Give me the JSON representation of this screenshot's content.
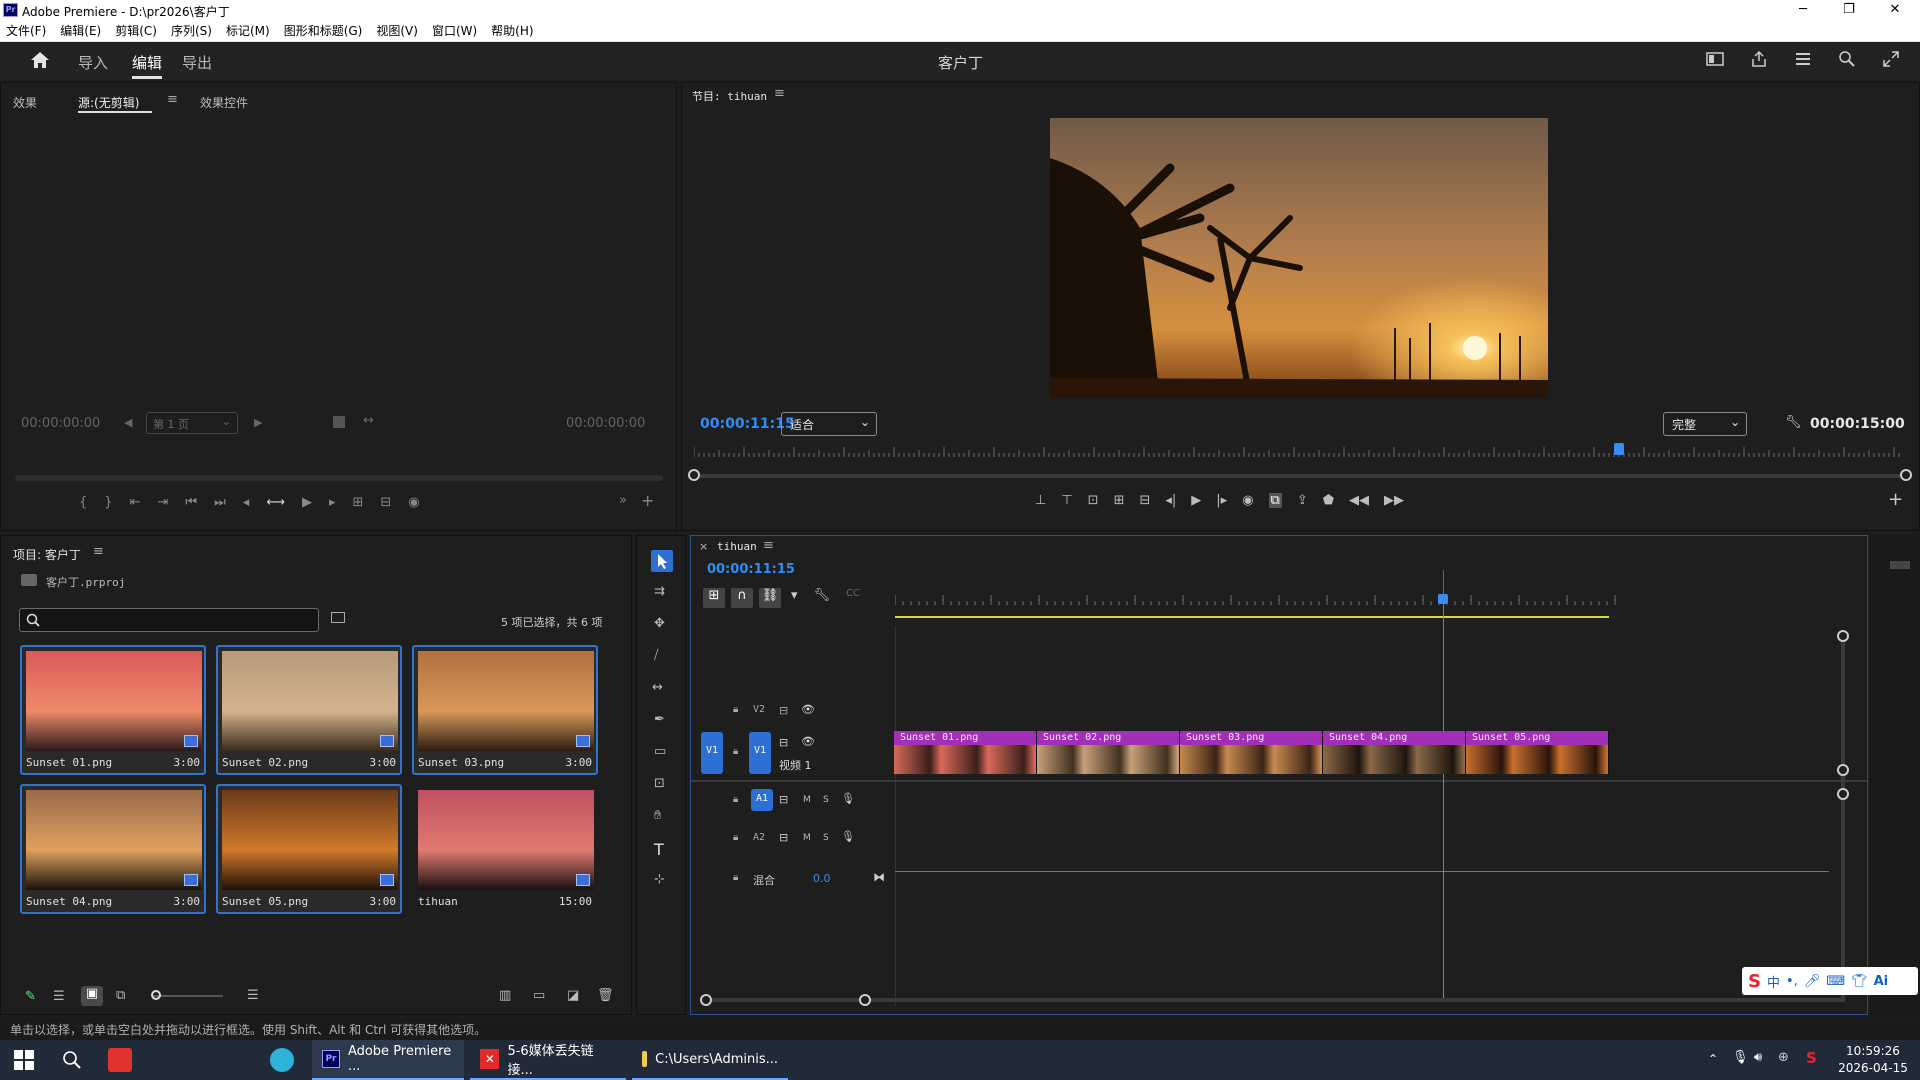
{
  "window": {
    "title": "Adobe Premiere - D:\\pr2026\\客户丁",
    "controls": [
      "─",
      "❐",
      "✕"
    ]
  },
  "menu": [
    "文件(F)",
    "编辑(E)",
    "剪辑(C)",
    "序列(S)",
    "标记(M)",
    "图形和标题(G)",
    "视图(V)",
    "窗口(W)",
    "帮助(H)"
  ],
  "header": {
    "tabs": [
      "导入",
      "编辑",
      "导出"
    ],
    "active_tab": "编辑",
    "project_name": "客户丁"
  },
  "source_panel": {
    "tabs": [
      "效果",
      "源:(无剪辑)",
      "效果控件"
    ],
    "timecode_in": "00:00:00:00",
    "timecode_out": "00:00:00:00",
    "page_select": "第 1 页"
  },
  "program_panel": {
    "title": "节目: tihuan",
    "timecode": "00:00:11:15",
    "fit": "适合",
    "quality": "完整",
    "duration": "00:00:15:00",
    "playhead_fraction": 0.767
  },
  "project_panel": {
    "title": "项目: 客户丁",
    "file": "客户丁.prproj",
    "search_placeholder": "",
    "selection": "5 项已选择，共 6 项",
    "items": [
      {
        "name": "Sunset 01.png",
        "duration": "3:00",
        "selected": true
      },
      {
        "name": "Sunset 02.png",
        "duration": "3:00",
        "selected": true
      },
      {
        "name": "Sunset 03.png",
        "duration": "3:00",
        "selected": true
      },
      {
        "name": "Sunset 04.png",
        "duration": "3:00",
        "selected": true
      },
      {
        "name": "Sunset 05.png",
        "duration": "3:00",
        "selected": true
      },
      {
        "name": "tihuan",
        "duration": "15:00",
        "selected": false
      }
    ]
  },
  "timeline": {
    "sequence": "tihuan",
    "timecode": "00:00:11:15",
    "tracks": {
      "v2": "V2",
      "v1": "V1",
      "v1_src": "V1",
      "v1_name": "视频 1",
      "a1": "A1",
      "a2": "A2",
      "mix": "混合",
      "mix_value": "0.0",
      "m": "M",
      "s": "S"
    },
    "clips": [
      "Sunset 01.png",
      "Sunset 02.png",
      "Sunset 03.png",
      "Sunset 04.png",
      "Sunset 05.png"
    ]
  },
  "status_bar": "单击以选择，或单击空白处并拖动以进行框选。使用 Shift、Alt 和 Ctrl 可获得其他选项。",
  "taskbar": {
    "items": [
      "Adobe Premiere ...",
      "5-6媒体丢失链接...",
      "C:\\Users\\Adminis..."
    ],
    "time": "10:59:26",
    "date": "2026-04-15",
    "ime": "中"
  },
  "colors": {
    "accent": "#2f8df5",
    "clip": "#a230b6",
    "selection": "#2f74d0"
  }
}
